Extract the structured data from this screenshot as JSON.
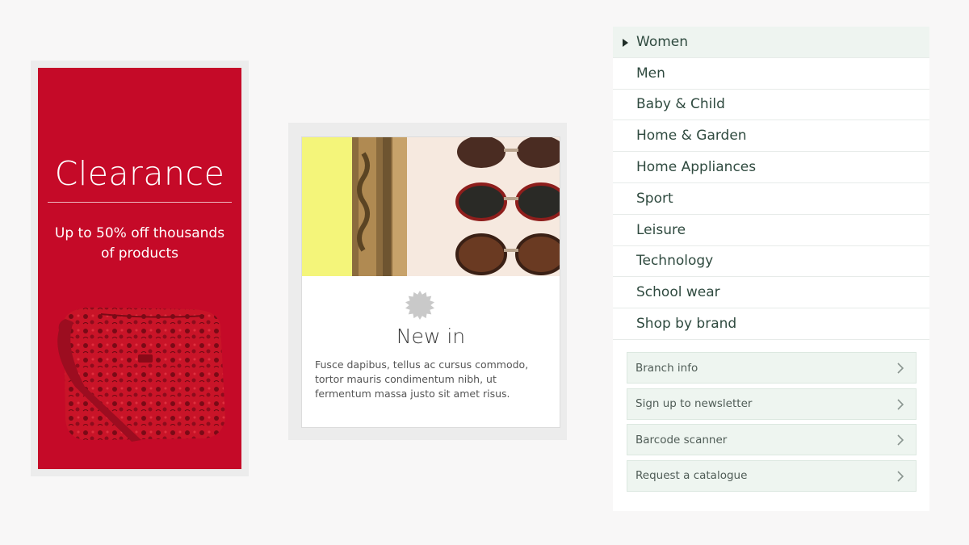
{
  "clearance": {
    "title": "Clearance",
    "subtitle": "Up to 50% off thousands of products",
    "background_color": "#c50a28",
    "image": "red-floral-handbag"
  },
  "new_in": {
    "title": "New in",
    "body": "Fusce dapibus, tellus ac cursus commodo, tortor mauris condimentum nibh, ut fermentum massa justo sit amet risus.",
    "image": "sunglasses-and-ornate-frame",
    "badge_icon": "seal-icon"
  },
  "menu": {
    "items": [
      {
        "label": "Women",
        "active": true
      },
      {
        "label": "Men"
      },
      {
        "label": "Baby & Child"
      },
      {
        "label": "Home & Garden"
      },
      {
        "label": "Home Appliances"
      },
      {
        "label": "Sport"
      },
      {
        "label": "Leisure"
      },
      {
        "label": "Technology"
      },
      {
        "label": "School wear"
      },
      {
        "label": "Shop by brand"
      }
    ],
    "links": [
      {
        "label": "Branch info"
      },
      {
        "label": "Sign up to newsletter"
      },
      {
        "label": "Barcode scanner"
      },
      {
        "label": "Request a catalogue"
      }
    ],
    "accent_color": "#eef4f0"
  }
}
